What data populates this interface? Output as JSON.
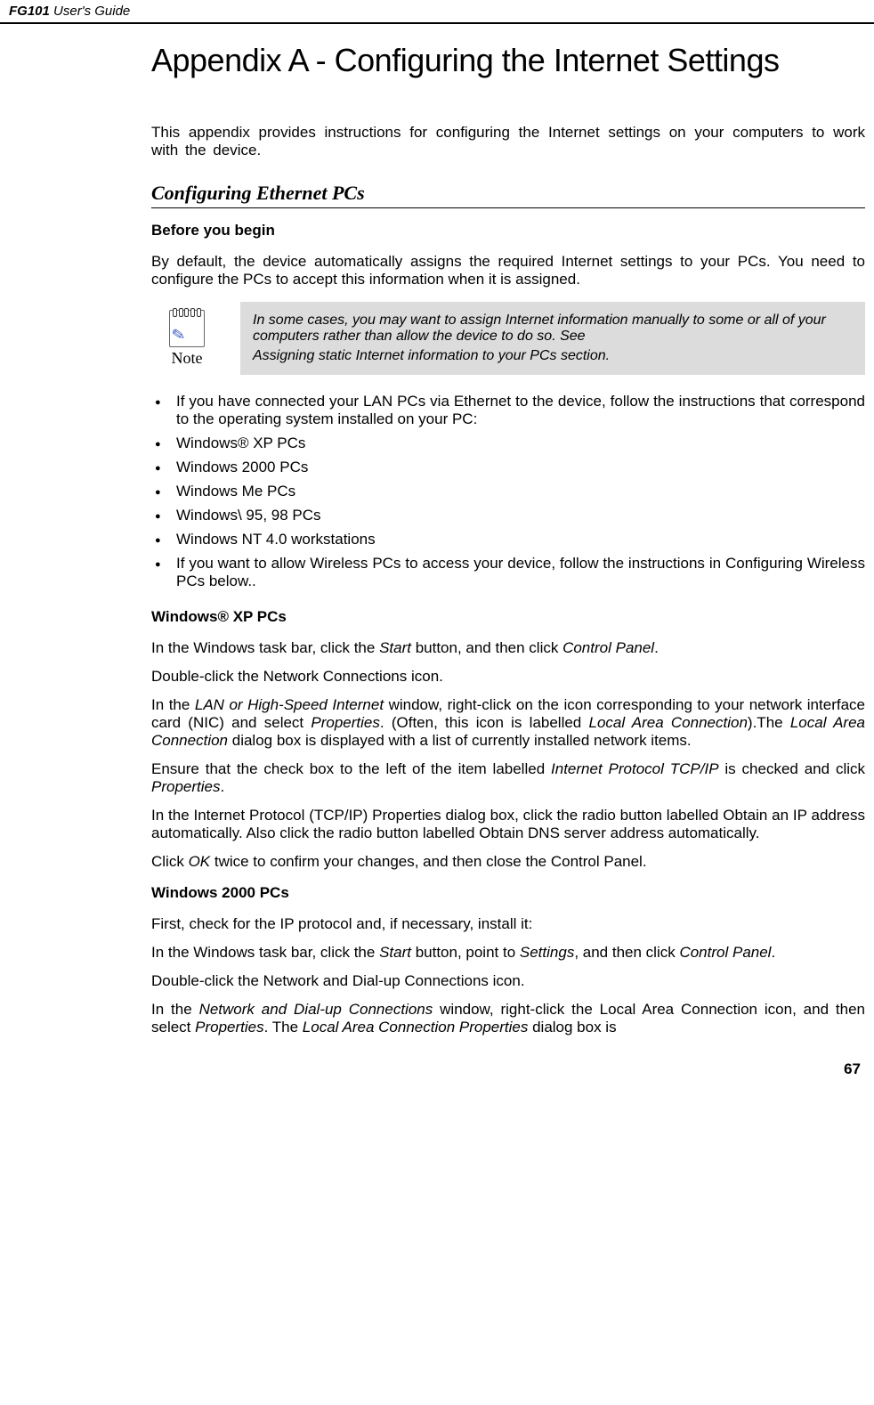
{
  "header": {
    "product": "FG101",
    "guide": "User's Guide"
  },
  "title": "Appendix A - Configuring the Internet Settings",
  "intro": "This appendix provides instructions for configuring the Internet settings on your computers to work with the device.",
  "section_heading": "Configuring Ethernet PCs",
  "before_begin": {
    "heading": "Before you begin",
    "para": "By default, the device automatically assigns the required Internet settings to your PCs. You need to configure the PCs to accept this information when it is assigned."
  },
  "note": {
    "label": "Note",
    "text1": "In some cases, you may want to assign Internet information manually to some or all of your computers rather than allow the device to do so. See",
    "text2": "Assigning static Internet information to your PCs section."
  },
  "bullets": [
    "If you have connected your LAN PCs via Ethernet to the device, follow the instructions that correspond to the operating system installed on your PC:",
    "Windows® XP PCs",
    "Windows 2000 PCs",
    "Windows Me PCs",
    "Windows\\ 95, 98 PCs",
    "Windows NT 4.0 workstations",
    "If you want to allow Wireless PCs to access your device, follow the instructions in Configuring Wireless PCs below.."
  ],
  "winxp": {
    "heading": "Windows® XP PCs",
    "p1_a": "In the Windows task bar, click the ",
    "p1_b": "Start",
    "p1_c": " button, and then click ",
    "p1_d": "Control Panel",
    "p1_e": ".",
    "p2": "Double-click the Network Connections icon.",
    "p3_a": "In the ",
    "p3_b": "LAN or High-Speed Internet",
    "p3_c": " window, right-click on the icon corresponding to your network interface card (NIC) and select ",
    "p3_d": "Properties",
    "p3_e": ". (Often, this icon is labelled ",
    "p3_f": "Local Area Connection",
    "p3_g": ").The ",
    "p3_h": "Local Area Connection",
    "p3_i": " dialog box is displayed with a list of currently installed network items.",
    "p4_a": "Ensure that the check box to the left of the item labelled ",
    "p4_b": "Internet Protocol TCP/IP",
    "p4_c": " is checked and click ",
    "p4_d": "Properties",
    "p4_e": ".",
    "p5": "In the Internet Protocol (TCP/IP) Properties dialog box, click the radio button labelled Obtain an IP address automatically. Also click the radio button labelled Obtain DNS server address automatically.",
    "p6_a": "Click ",
    "p6_b": "OK",
    "p6_c": " twice to confirm your changes, and then close the Control Panel."
  },
  "win2000": {
    "heading": "Windows 2000 PCs",
    "p1": "First, check for the IP protocol and, if necessary, install it:",
    "p2_a": "In the Windows task bar, click the ",
    "p2_b": "Start",
    "p2_c": " button, point to ",
    "p2_d": "Settings",
    "p2_e": ", and then click ",
    "p2_f": "Control Panel",
    "p2_g": ".",
    "p3": "Double-click the Network and Dial-up Connections icon.",
    "p4_a": "In the ",
    "p4_b": "Network and Dial-up Connections",
    "p4_c": " window, right-click the Local Area Connection icon, and then select ",
    "p4_d": "Properties",
    "p4_e": ". The ",
    "p4_f": "Local Area Connection Properties",
    "p4_g": " dialog box is"
  },
  "page_number": "67"
}
